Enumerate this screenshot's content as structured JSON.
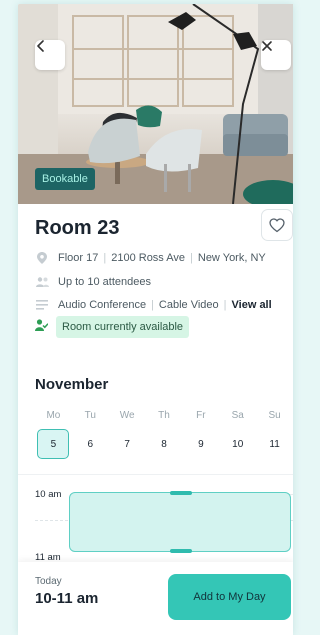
{
  "hero": {
    "badge": "Bookable",
    "back_icon": "chevron-left-icon",
    "close_icon": "close-icon"
  },
  "room": {
    "title": "Room 23",
    "favorite_icon": "heart-icon",
    "location": {
      "icon": "location-pin-icon",
      "floor": "Floor 17",
      "street": "2100 Ross Ave",
      "city": "New York, NY"
    },
    "capacity": {
      "icon": "people-icon",
      "text": "Up to 10 attendees"
    },
    "amenities": {
      "icon": "list-icon",
      "items": [
        "Audio Conference",
        "Cable Video"
      ],
      "view_all": "View all"
    },
    "availability": {
      "icon": "person-check-icon",
      "text": "Room currently available"
    }
  },
  "calendar": {
    "month": "November",
    "weekdays": [
      "Mo",
      "Tu",
      "We",
      "Th",
      "Fr",
      "Sa",
      "Su"
    ],
    "dates": [
      "5",
      "6",
      "7",
      "8",
      "9",
      "10",
      "11"
    ],
    "selected": "5"
  },
  "timeline": {
    "start_label": "10 am",
    "end_label": "11 am"
  },
  "footer": {
    "day": "Today",
    "time": "10-11 am",
    "button": "Add to My Day"
  },
  "colors": {
    "accent": "#34c6b6",
    "badge_bg": "#1d6464",
    "available_bg": "#d6f5e5",
    "booking_bg": "#d3f3ef"
  }
}
